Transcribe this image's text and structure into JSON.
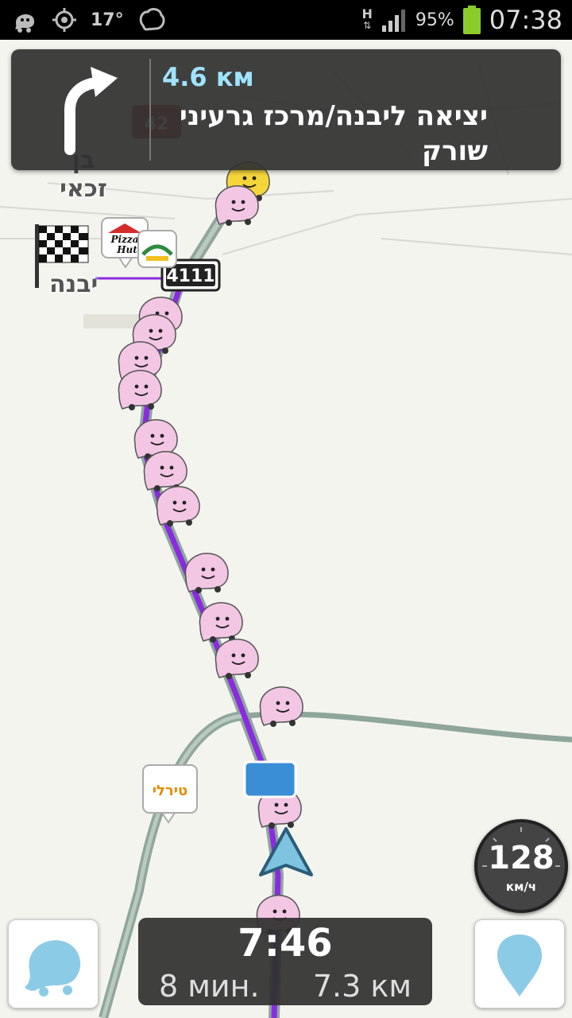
{
  "status_bar": {
    "temperature": "17°",
    "network_type": "H",
    "battery_percent": "95%",
    "time": "07:38"
  },
  "navigation": {
    "distance": "4.6 км",
    "instruction": "יציאה ליבנה/מרכז גרעיני שורק",
    "turn_direction": "right"
  },
  "map": {
    "labels": {
      "city_ben_zakai": "בן זכאי",
      "city_yavne": "יבנה"
    },
    "road_shield": "4111",
    "road_shield_partial": "42",
    "poi_pizza_hut_line1": "Pizza",
    "poi_pizza_hut_line2": "Hut",
    "poi_tirtli": "טירלי",
    "route_color": "#8a2be2",
    "road_color": "#8fa69b"
  },
  "speedometer": {
    "speed": "128",
    "unit": "км/ч"
  },
  "eta": {
    "arrival_time": "7:46",
    "duration": "8 мин.",
    "remaining_distance": "7.3 км"
  },
  "buttons": {
    "menu_icon": "waze-icon",
    "report_icon": "pin-icon"
  }
}
